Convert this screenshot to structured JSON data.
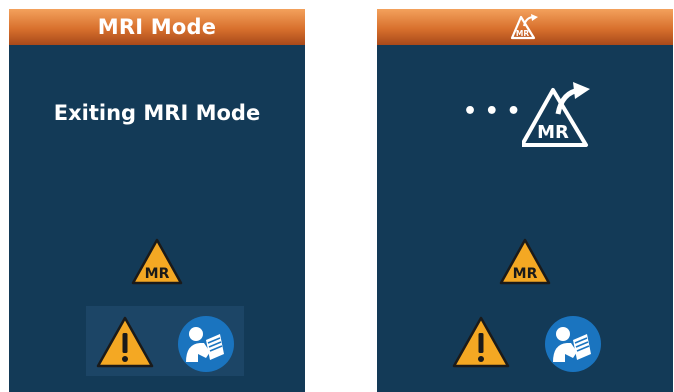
{
  "screens": [
    {
      "header_title": "MRI Mode",
      "message": "Exiting MRI Mode",
      "icons": [
        "mr-warning-icon",
        "caution-icon",
        "consult-manual-icon"
      ]
    },
    {
      "header_icon": "mr-conditional-exit-icon",
      "progress_dots": "• • •",
      "main_icon": "mr-conditional-exit-icon",
      "icons": [
        "mr-warning-icon",
        "caution-icon",
        "consult-manual-icon"
      ]
    }
  ],
  "mr_label": "MR",
  "colors": {
    "screen_bg": "#133a57",
    "header_orange": "#d8702d",
    "warning_yellow": "#f4a823",
    "manual_blue": "#1a74bf"
  }
}
